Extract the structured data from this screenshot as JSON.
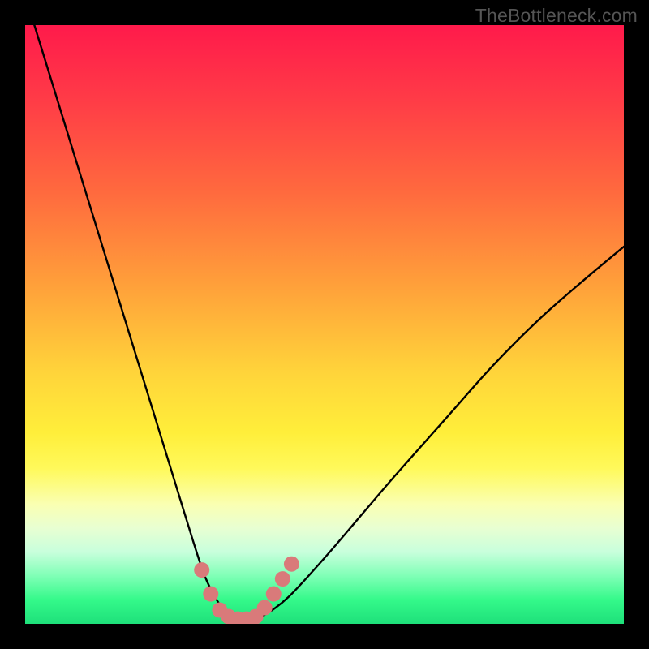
{
  "watermark": "TheBottleneck.com",
  "chart_data": {
    "type": "line",
    "title": "",
    "xlabel": "",
    "ylabel": "",
    "xlim": [
      0,
      100
    ],
    "ylim": [
      0,
      100
    ],
    "series": [
      {
        "name": "bottleneck-curve",
        "x": [
          0,
          4,
          8,
          12,
          16,
          20,
          24,
          28,
          30,
          32,
          34,
          36,
          38,
          40,
          44,
          50,
          56,
          62,
          70,
          78,
          86,
          94,
          100
        ],
        "y": [
          105,
          92,
          79,
          66,
          53,
          40,
          27,
          14,
          8,
          4,
          1.5,
          0.8,
          0.8,
          1.5,
          4.5,
          11,
          18,
          25,
          34,
          43,
          51,
          58,
          63
        ]
      }
    ],
    "markers": {
      "name": "highlight-dots",
      "color": "#d97a7a",
      "points": [
        {
          "x": 29.5,
          "y": 9
        },
        {
          "x": 31,
          "y": 5
        },
        {
          "x": 32.5,
          "y": 2.3
        },
        {
          "x": 34,
          "y": 1.2
        },
        {
          "x": 35.5,
          "y": 0.8
        },
        {
          "x": 37,
          "y": 0.8
        },
        {
          "x": 38.5,
          "y": 1.2
        },
        {
          "x": 40,
          "y": 2.7
        },
        {
          "x": 41.5,
          "y": 5
        },
        {
          "x": 43,
          "y": 7.5
        },
        {
          "x": 44.5,
          "y": 10
        }
      ]
    }
  }
}
